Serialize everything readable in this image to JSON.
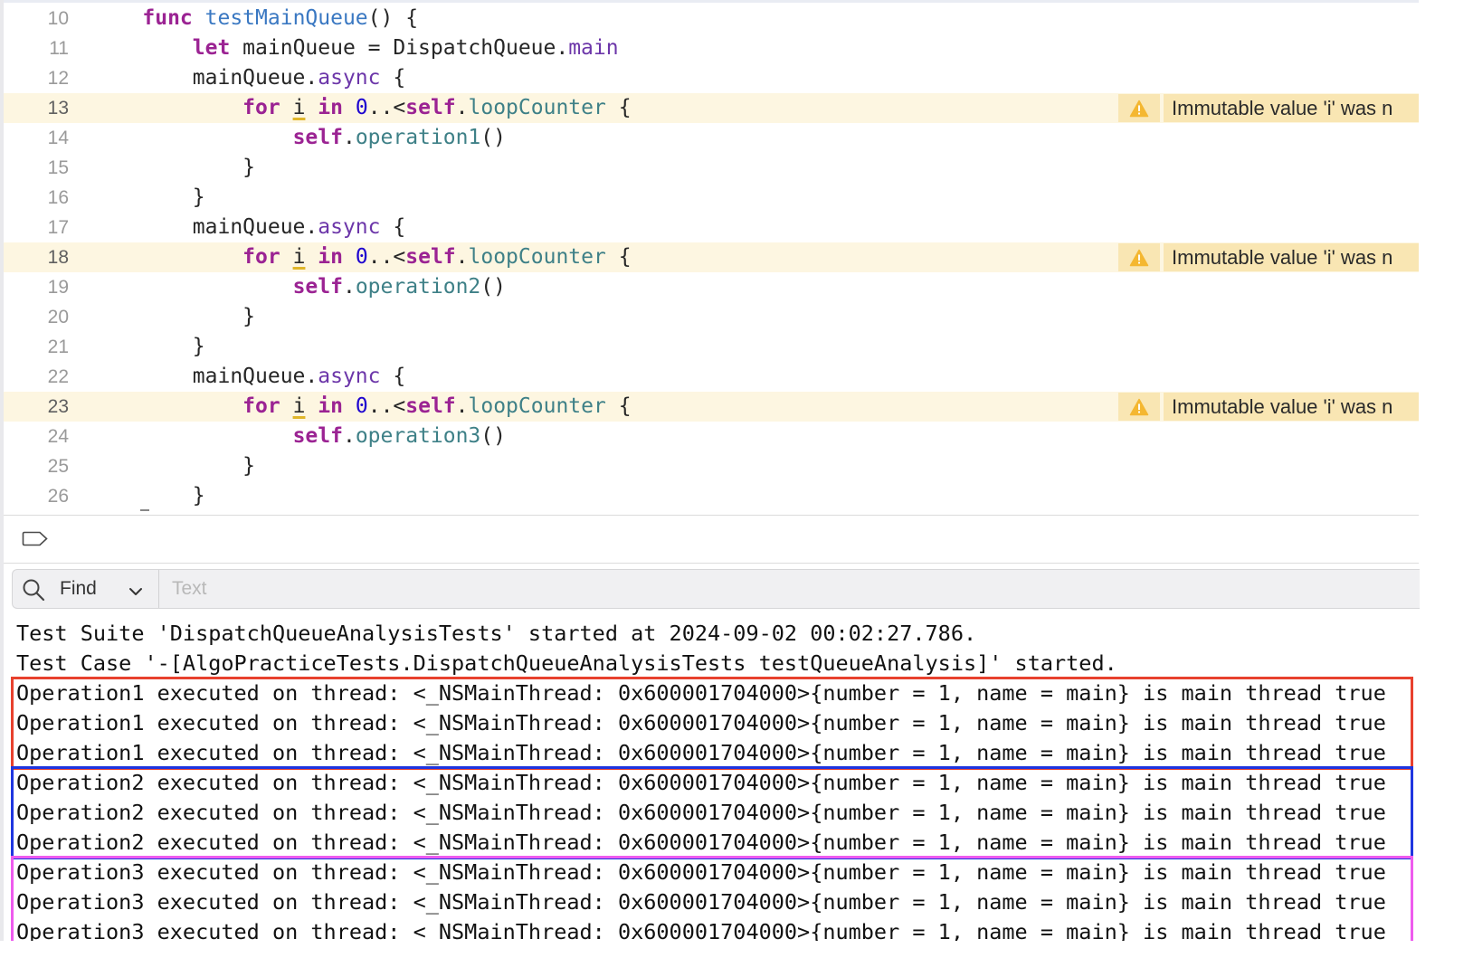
{
  "colors": {
    "editor_bg": "#ffffff",
    "warning_line_bg": "#fdf6e1",
    "warning_badge_bg": "#f9e6b3",
    "keyword": "#9b2393",
    "function_decl": "#3a78c2",
    "member": "#3e8087",
    "property": "#6c36a9",
    "number_literal": "#1c00cf",
    "box_red": "#e8412e",
    "box_blue": "#1f36e0",
    "box_magenta": "#ee5bee"
  },
  "editor": {
    "lines": [
      {
        "number": "10",
        "warning": false,
        "tokens": [
          {
            "t": "    "
          },
          {
            "t": "func",
            "c": "kw"
          },
          {
            "t": " "
          },
          {
            "t": "testMainQueue",
            "c": "fn"
          },
          {
            "t": "() {"
          }
        ]
      },
      {
        "number": "11",
        "warning": false,
        "tokens": [
          {
            "t": "        "
          },
          {
            "t": "let",
            "c": "kw"
          },
          {
            "t": " mainQueue = DispatchQueue."
          },
          {
            "t": "main",
            "c": "prop"
          }
        ]
      },
      {
        "number": "12",
        "warning": false,
        "tokens": [
          {
            "t": "        mainQueue."
          },
          {
            "t": "async",
            "c": "prop"
          },
          {
            "t": " {"
          }
        ]
      },
      {
        "number": "13",
        "warning": true,
        "tokens": [
          {
            "t": "            "
          },
          {
            "t": "for",
            "c": "kw"
          },
          {
            "t": " "
          },
          {
            "t": "i",
            "c": "wvar"
          },
          {
            "t": " "
          },
          {
            "t": "in",
            "c": "kw"
          },
          {
            "t": " "
          },
          {
            "t": "0",
            "c": "num"
          },
          {
            "t": "..<"
          },
          {
            "t": "self",
            "c": "kw"
          },
          {
            "t": "."
          },
          {
            "t": "loopCounter",
            "c": "mem"
          },
          {
            "t": " {"
          }
        ]
      },
      {
        "number": "14",
        "warning": false,
        "tokens": [
          {
            "t": "                "
          },
          {
            "t": "self",
            "c": "kw"
          },
          {
            "t": "."
          },
          {
            "t": "operation1",
            "c": "mem"
          },
          {
            "t": "()"
          }
        ]
      },
      {
        "number": "15",
        "warning": false,
        "tokens": [
          {
            "t": "            }"
          }
        ]
      },
      {
        "number": "16",
        "warning": false,
        "tokens": [
          {
            "t": "        }"
          }
        ]
      },
      {
        "number": "17",
        "warning": false,
        "tokens": [
          {
            "t": "        mainQueue."
          },
          {
            "t": "async",
            "c": "prop"
          },
          {
            "t": " {"
          }
        ]
      },
      {
        "number": "18",
        "warning": true,
        "tokens": [
          {
            "t": "            "
          },
          {
            "t": "for",
            "c": "kw"
          },
          {
            "t": " "
          },
          {
            "t": "i",
            "c": "wvar"
          },
          {
            "t": " "
          },
          {
            "t": "in",
            "c": "kw"
          },
          {
            "t": " "
          },
          {
            "t": "0",
            "c": "num"
          },
          {
            "t": "..<"
          },
          {
            "t": "self",
            "c": "kw"
          },
          {
            "t": "."
          },
          {
            "t": "loopCounter",
            "c": "mem"
          },
          {
            "t": " {"
          }
        ]
      },
      {
        "number": "19",
        "warning": false,
        "tokens": [
          {
            "t": "                "
          },
          {
            "t": "self",
            "c": "kw"
          },
          {
            "t": "."
          },
          {
            "t": "operation2",
            "c": "mem"
          },
          {
            "t": "()"
          }
        ]
      },
      {
        "number": "20",
        "warning": false,
        "tokens": [
          {
            "t": "            }"
          }
        ]
      },
      {
        "number": "21",
        "warning": false,
        "tokens": [
          {
            "t": "        }"
          }
        ]
      },
      {
        "number": "22",
        "warning": false,
        "tokens": [
          {
            "t": "        mainQueue."
          },
          {
            "t": "async",
            "c": "prop"
          },
          {
            "t": " {"
          }
        ]
      },
      {
        "number": "23",
        "warning": true,
        "tokens": [
          {
            "t": "            "
          },
          {
            "t": "for",
            "c": "kw"
          },
          {
            "t": " "
          },
          {
            "t": "i",
            "c": "wvar"
          },
          {
            "t": " "
          },
          {
            "t": "in",
            "c": "kw"
          },
          {
            "t": " "
          },
          {
            "t": "0",
            "c": "num"
          },
          {
            "t": "..<"
          },
          {
            "t": "self",
            "c": "kw"
          },
          {
            "t": "."
          },
          {
            "t": "loopCounter",
            "c": "mem"
          },
          {
            "t": " {"
          }
        ]
      },
      {
        "number": "24",
        "warning": false,
        "tokens": [
          {
            "t": "                "
          },
          {
            "t": "self",
            "c": "kw"
          },
          {
            "t": "."
          },
          {
            "t": "operation3",
            "c": "mem"
          },
          {
            "t": "()"
          }
        ]
      },
      {
        "number": "25",
        "warning": false,
        "tokens": [
          {
            "t": "            }"
          }
        ]
      },
      {
        "number": "26",
        "warning": false,
        "tokens": [
          {
            "t": "        }"
          }
        ]
      }
    ],
    "warning_message": "Immutable value 'i' was n",
    "warning_icon": "warning-triangle-icon"
  },
  "divider": {
    "icon": "breakpoint-tag-icon"
  },
  "find_bar": {
    "search_icon": "magnifying-glass-icon",
    "mode_label": "Find",
    "mode_icon": "chevron-down-icon",
    "placeholder": "Text"
  },
  "console": {
    "lines": [
      "Test Suite 'DispatchQueueAnalysisTests' started at 2024-09-02 00:02:27.786.",
      "Test Case '-[AlgoPracticeTests.DispatchQueueAnalysisTests testQueueAnalysis]' started.",
      "Operation1 executed on thread: <_NSMainThread: 0x600001704000>{number = 1, name = main} is main thread true",
      "Operation1 executed on thread: <_NSMainThread: 0x600001704000>{number = 1, name = main} is main thread true",
      "Operation1 executed on thread: <_NSMainThread: 0x600001704000>{number = 1, name = main} is main thread true",
      "Operation2 executed on thread: <_NSMainThread: 0x600001704000>{number = 1, name = main} is main thread true",
      "Operation2 executed on thread: <_NSMainThread: 0x600001704000>{number = 1, name = main} is main thread true",
      "Operation2 executed on thread: <_NSMainThread: 0x600001704000>{number = 1, name = main} is main thread true",
      "Operation3 executed on thread: <_NSMainThread: 0x600001704000>{number = 1, name = main} is main thread true",
      "Operation3 executed on thread: <_NSMainThread: 0x600001704000>{number = 1, name = main} is main thread true",
      "Operation3 executed on thread: <_NSMainThread: 0x600001704000>{number = 1, name = main} is main thread true"
    ],
    "highlight_groups": [
      {
        "label": "Operation1",
        "color": "#e8412e",
        "first_line": 2,
        "last_line": 4
      },
      {
        "label": "Operation2",
        "color": "#1f36e0",
        "first_line": 5,
        "last_line": 7
      },
      {
        "label": "Operation3",
        "color": "#ee5bee",
        "first_line": 8,
        "last_line": 10
      }
    ]
  }
}
